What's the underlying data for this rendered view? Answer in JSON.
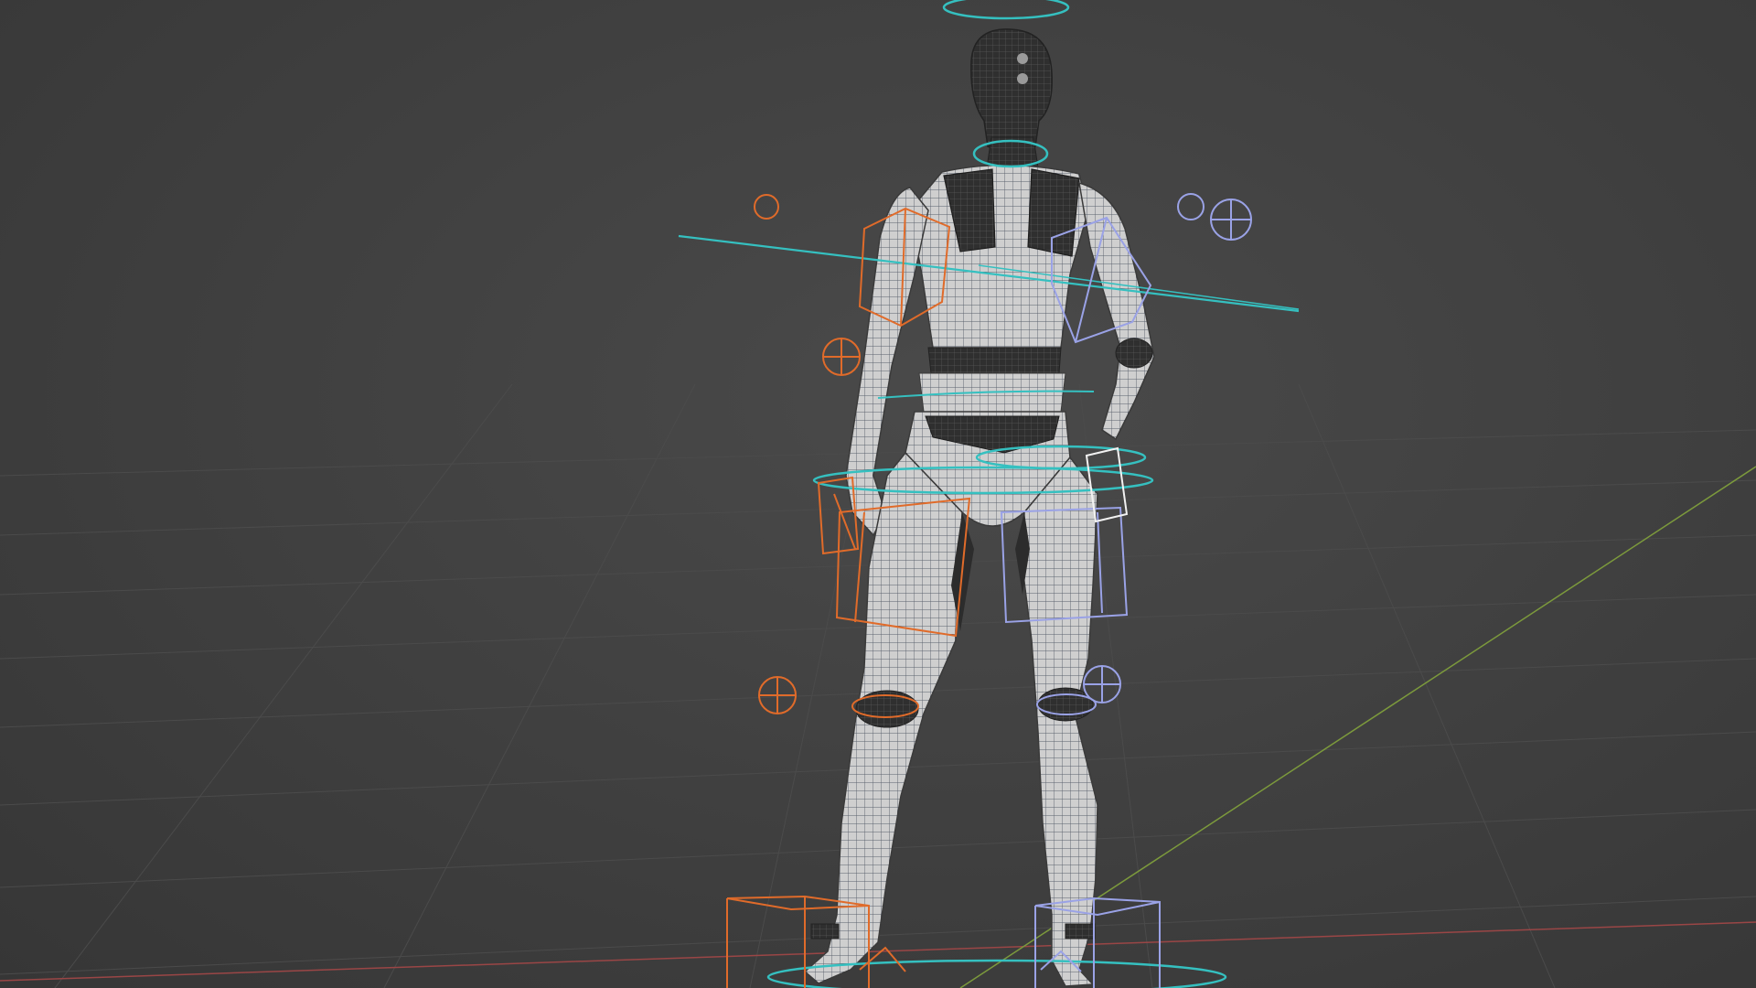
{
  "viewport": {
    "mode": "3d-viewport-wireframe",
    "colors": {
      "background": "#3e3e3e",
      "floor_grid": "#4c4c4c",
      "axis_x": "#9a4646",
      "axis_y": "#7c9a3c",
      "mesh_fill": "#c9c9c9",
      "mesh_dark": "#2e2e2e",
      "mesh_wire": "#444a55",
      "control_left": "#e06b2a",
      "control_right": "#9aa2e6",
      "control_center": "#35c0c0",
      "control_selected": "#ffffff"
    }
  },
  "icons": {
    "hand_ik_left": "circle-cross-icon",
    "hand_ik_right": "circle-cross-icon",
    "knee_pole_left": "circle-cross-icon",
    "knee_pole_right": "circle-cross-icon",
    "elbow_pole_left": "circle-icon",
    "elbow_pole_right": "circle-icon",
    "foot_ik_left": "cube-icon",
    "foot_ik_right": "cube-icon"
  }
}
